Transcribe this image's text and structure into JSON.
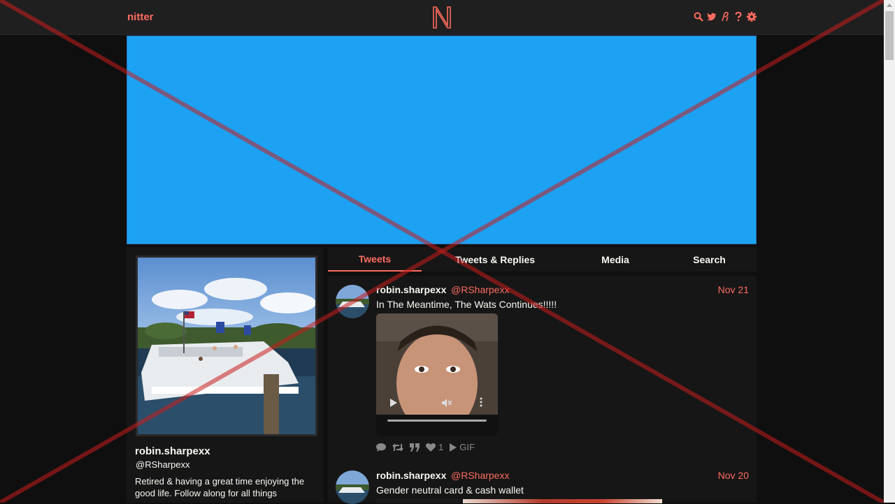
{
  "navbar": {
    "brand": "nitter",
    "logo_letter": "N",
    "icons": [
      "search-icon",
      "twitter-bird-icon",
      "rss-icon",
      "help-icon",
      "gear-icon"
    ]
  },
  "profile": {
    "fullname": "robin.sharpexx",
    "username": "@RSharpexx",
    "bio": "Retired & having a great time enjoying the good life.  Follow along for all things"
  },
  "tabs": [
    {
      "label": "Tweets",
      "active": true
    },
    {
      "label": "Tweets & Replies",
      "active": false
    },
    {
      "label": "Media",
      "active": false
    },
    {
      "label": "Search",
      "active": false
    }
  ],
  "tweets": [
    {
      "fullname": "robin.sharpexx",
      "username": "@RSharpexx",
      "date": "Nov 21",
      "text": "In The Meantime, The Wats Continues!!!!!",
      "likes": "1",
      "media_label": "GIF"
    },
    {
      "fullname": "robin.sharpexx",
      "username": "@RSharpexx",
      "date": "Nov 20",
      "text": "Gender neutral card & cash wallet"
    }
  ],
  "colors": {
    "accent": "#ff6c60",
    "background": "#0f0f0f",
    "panel": "#161616",
    "banner": "#1da1f2"
  }
}
